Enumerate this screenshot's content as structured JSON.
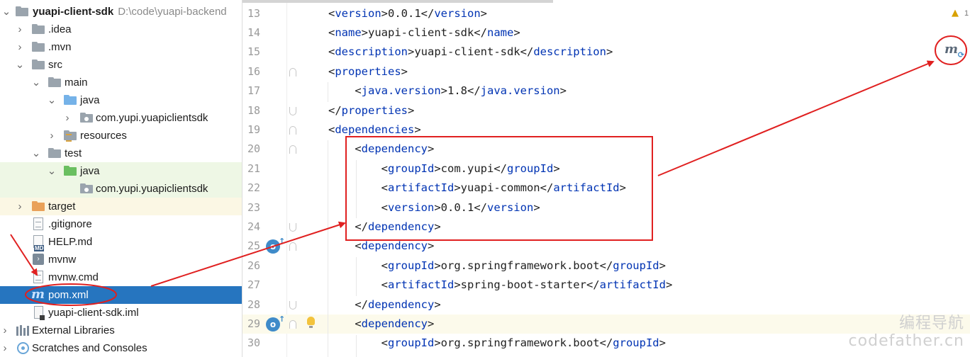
{
  "tree": {
    "root": {
      "label": "yuapi-client-sdk",
      "path_hint": "D:\\code\\yuapi-backend"
    },
    "items": [
      {
        "label": ".idea"
      },
      {
        "label": ".mvn"
      },
      {
        "label": "src"
      },
      {
        "label": "main"
      },
      {
        "label": "java"
      },
      {
        "label": "com.yupi.yuapiclientsdk"
      },
      {
        "label": "resources"
      },
      {
        "label": "test"
      },
      {
        "label": "java"
      },
      {
        "label": "com.yupi.yuapiclientsdk"
      },
      {
        "label": "target"
      },
      {
        "label": ".gitignore"
      },
      {
        "label": "HELP.md"
      },
      {
        "label": "mvnw"
      },
      {
        "label": "mvnw.cmd"
      },
      {
        "label": "pom.xml"
      },
      {
        "label": "yuapi-client-sdk.iml"
      },
      {
        "label": "External Libraries"
      },
      {
        "label": "Scratches and Consoles"
      }
    ]
  },
  "editor": {
    "lines": [
      {
        "n": "13",
        "tokens": [
          [
            "p",
            "<"
          ],
          [
            "t",
            "version"
          ],
          [
            "p",
            ">0.0.1</"
          ],
          [
            "t",
            "version"
          ],
          [
            "p",
            ">"
          ]
        ]
      },
      {
        "n": "14",
        "tokens": [
          [
            "p",
            "<"
          ],
          [
            "t",
            "name"
          ],
          [
            "p",
            ">yuapi-client-sdk</"
          ],
          [
            "t",
            "name"
          ],
          [
            "p",
            ">"
          ]
        ]
      },
      {
        "n": "15",
        "tokens": [
          [
            "p",
            "<"
          ],
          [
            "t",
            "description"
          ],
          [
            "p",
            ">yuapi-client-sdk</"
          ],
          [
            "t",
            "description"
          ],
          [
            "p",
            ">"
          ]
        ]
      },
      {
        "n": "16",
        "tokens": [
          [
            "p",
            "<"
          ],
          [
            "t",
            "properties"
          ],
          [
            "p",
            ">"
          ]
        ]
      },
      {
        "n": "17",
        "tokens": [
          [
            "p",
            "    <"
          ],
          [
            "t",
            "java.version"
          ],
          [
            "p",
            ">1.8</"
          ],
          [
            "t",
            "java.version"
          ],
          [
            "p",
            ">"
          ]
        ]
      },
      {
        "n": "18",
        "tokens": [
          [
            "p",
            "</"
          ],
          [
            "t",
            "properties"
          ],
          [
            "p",
            ">"
          ]
        ]
      },
      {
        "n": "19",
        "tokens": [
          [
            "p",
            "<"
          ],
          [
            "t",
            "dependencies"
          ],
          [
            "p",
            ">"
          ]
        ]
      },
      {
        "n": "20",
        "tokens": [
          [
            "p",
            "    <"
          ],
          [
            "t",
            "dependency"
          ],
          [
            "p",
            ">"
          ]
        ]
      },
      {
        "n": "21",
        "tokens": [
          [
            "p",
            "        <"
          ],
          [
            "t",
            "groupId"
          ],
          [
            "p",
            ">com.yupi</"
          ],
          [
            "t",
            "groupId"
          ],
          [
            "p",
            ">"
          ]
        ]
      },
      {
        "n": "22",
        "tokens": [
          [
            "p",
            "        <"
          ],
          [
            "t",
            "artifactId"
          ],
          [
            "p",
            ">yuapi-common</"
          ],
          [
            "t",
            "artifactId"
          ],
          [
            "p",
            ">"
          ]
        ]
      },
      {
        "n": "23",
        "tokens": [
          [
            "p",
            "        <"
          ],
          [
            "t",
            "version"
          ],
          [
            "p",
            ">0.0.1</"
          ],
          [
            "t",
            "version"
          ],
          [
            "p",
            ">"
          ]
        ]
      },
      {
        "n": "24",
        "tokens": [
          [
            "p",
            "    </"
          ],
          [
            "t",
            "dependency"
          ],
          [
            "p",
            ">"
          ]
        ]
      },
      {
        "n": "25",
        "tokens": [
          [
            "p",
            "    <"
          ],
          [
            "t",
            "dependency"
          ],
          [
            "p",
            ">"
          ]
        ]
      },
      {
        "n": "26",
        "tokens": [
          [
            "p",
            "        <"
          ],
          [
            "t",
            "groupId"
          ],
          [
            "p",
            ">org.springframework.boot</"
          ],
          [
            "t",
            "groupId"
          ],
          [
            "p",
            ">"
          ]
        ]
      },
      {
        "n": "27",
        "tokens": [
          [
            "p",
            "        <"
          ],
          [
            "t",
            "artifactId"
          ],
          [
            "p",
            ">spring-boot-starter</"
          ],
          [
            "t",
            "artifactId"
          ],
          [
            "p",
            ">"
          ]
        ]
      },
      {
        "n": "28",
        "tokens": [
          [
            "p",
            "    </"
          ],
          [
            "t",
            "dependency"
          ],
          [
            "p",
            ">"
          ]
        ]
      },
      {
        "n": "29",
        "tokens": [
          [
            "p",
            "    <"
          ],
          [
            "t",
            "dependency"
          ],
          [
            "p",
            ">"
          ]
        ]
      },
      {
        "n": "30",
        "tokens": [
          [
            "p",
            "        <"
          ],
          [
            "t",
            "groupId"
          ],
          [
            "p",
            ">org.springframework.boot</"
          ],
          [
            "t",
            "groupId"
          ],
          [
            "p",
            ">"
          ]
        ]
      }
    ],
    "warning_count": "1"
  },
  "watermark": {
    "line1": "编程导航",
    "line2": "codefather.cn"
  },
  "colors": {
    "xml_tag": "#0033b3",
    "selection": "#2675bf",
    "annotation_red": "#e02020"
  }
}
